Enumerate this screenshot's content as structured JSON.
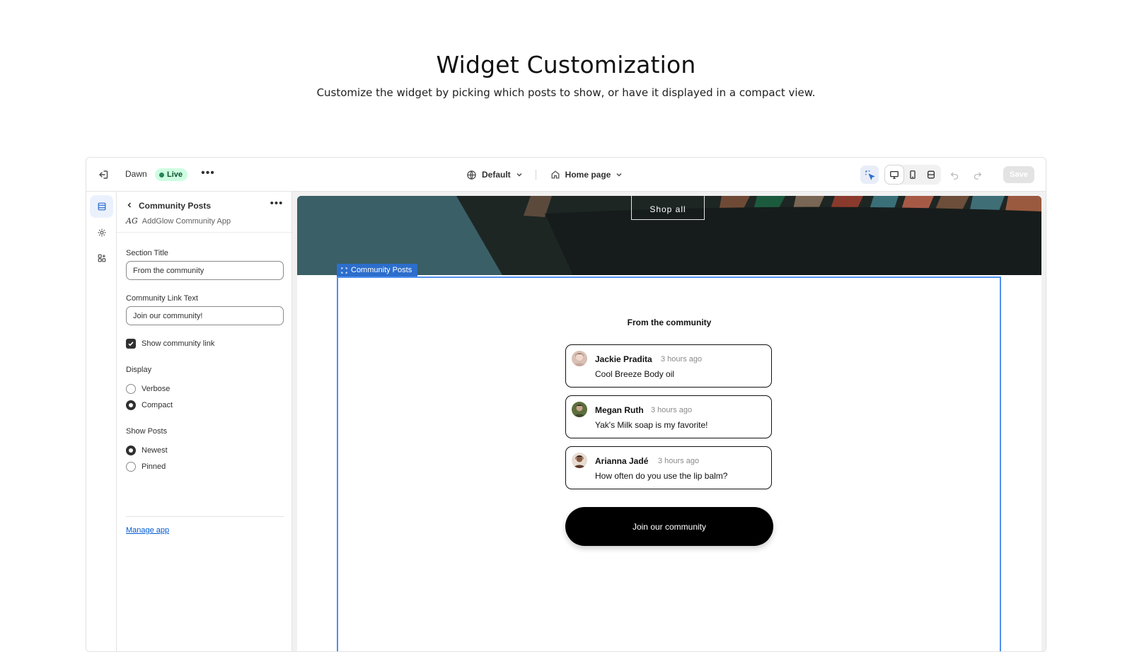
{
  "hero": {
    "title": "Widget Customization",
    "subtitle": "Customize the widget by picking which posts to show, or have it displayed in a compact view."
  },
  "topbar": {
    "theme_name": "Dawn",
    "live_badge": "Live",
    "more": "•••",
    "preset_dropdown": "Default",
    "page_dropdown": "Home page",
    "save_label": "Save"
  },
  "panel": {
    "title": "Community Posts",
    "more": "•••",
    "app_logo": "AG",
    "app_name": "AddGlow Community App",
    "section_title_label": "Section Title",
    "section_title_value": "From the community",
    "link_text_label": "Community Link Text",
    "link_text_value": "Join our community!",
    "show_link_label": "Show community link",
    "show_link_checked": true,
    "display_label": "Display",
    "display_options": [
      "Verbose",
      "Compact"
    ],
    "display_selected": "Compact",
    "show_posts_label": "Show Posts",
    "show_posts_options": [
      "Newest",
      "Pinned"
    ],
    "show_posts_selected": "Newest",
    "manage_link": "Manage app"
  },
  "preview": {
    "shop_all": "Shop all",
    "section_tag": "Community Posts",
    "widget_title": "From the community",
    "posts": [
      {
        "author": "Jackie Pradita",
        "time": "3 hours ago",
        "text": "Cool Breeze Body oil"
      },
      {
        "author": "Megan Ruth",
        "time": "3 hours ago",
        "text": "Yak's Milk soap is my favorite!"
      },
      {
        "author": "Arianna Jadé",
        "time": "3 hours ago",
        "text": "How often do you use the lip balm?"
      }
    ],
    "join_button": "Join our community"
  },
  "colors": {
    "accent_blue": "#2c6ecb",
    "live_green": "#29845a",
    "banner_teal": "#3a5f66"
  }
}
